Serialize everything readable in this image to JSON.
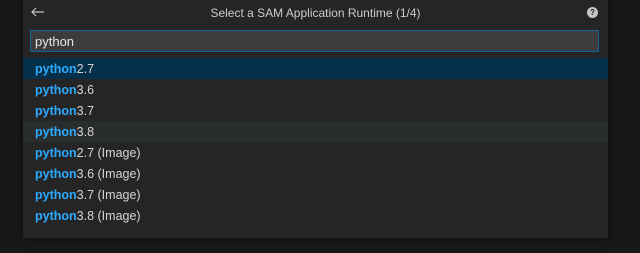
{
  "quickpick": {
    "title": "Select a SAM Application Runtime (1/4)",
    "back_icon": "arrow-left-icon",
    "help_icon": "question-icon",
    "help_glyph": "?",
    "input_value": "python",
    "items": [
      {
        "match": "python",
        "rest": "2.7"
      },
      {
        "match": "python",
        "rest": "3.6"
      },
      {
        "match": "python",
        "rest": "3.7"
      },
      {
        "match": "python",
        "rest": "3.8"
      },
      {
        "match": "python",
        "rest": "2.7 (Image)"
      },
      {
        "match": "python",
        "rest": "3.6 (Image)"
      },
      {
        "match": "python",
        "rest": "3.7 (Image)"
      },
      {
        "match": "python",
        "rest": "3.8 (Image)"
      }
    ]
  }
}
